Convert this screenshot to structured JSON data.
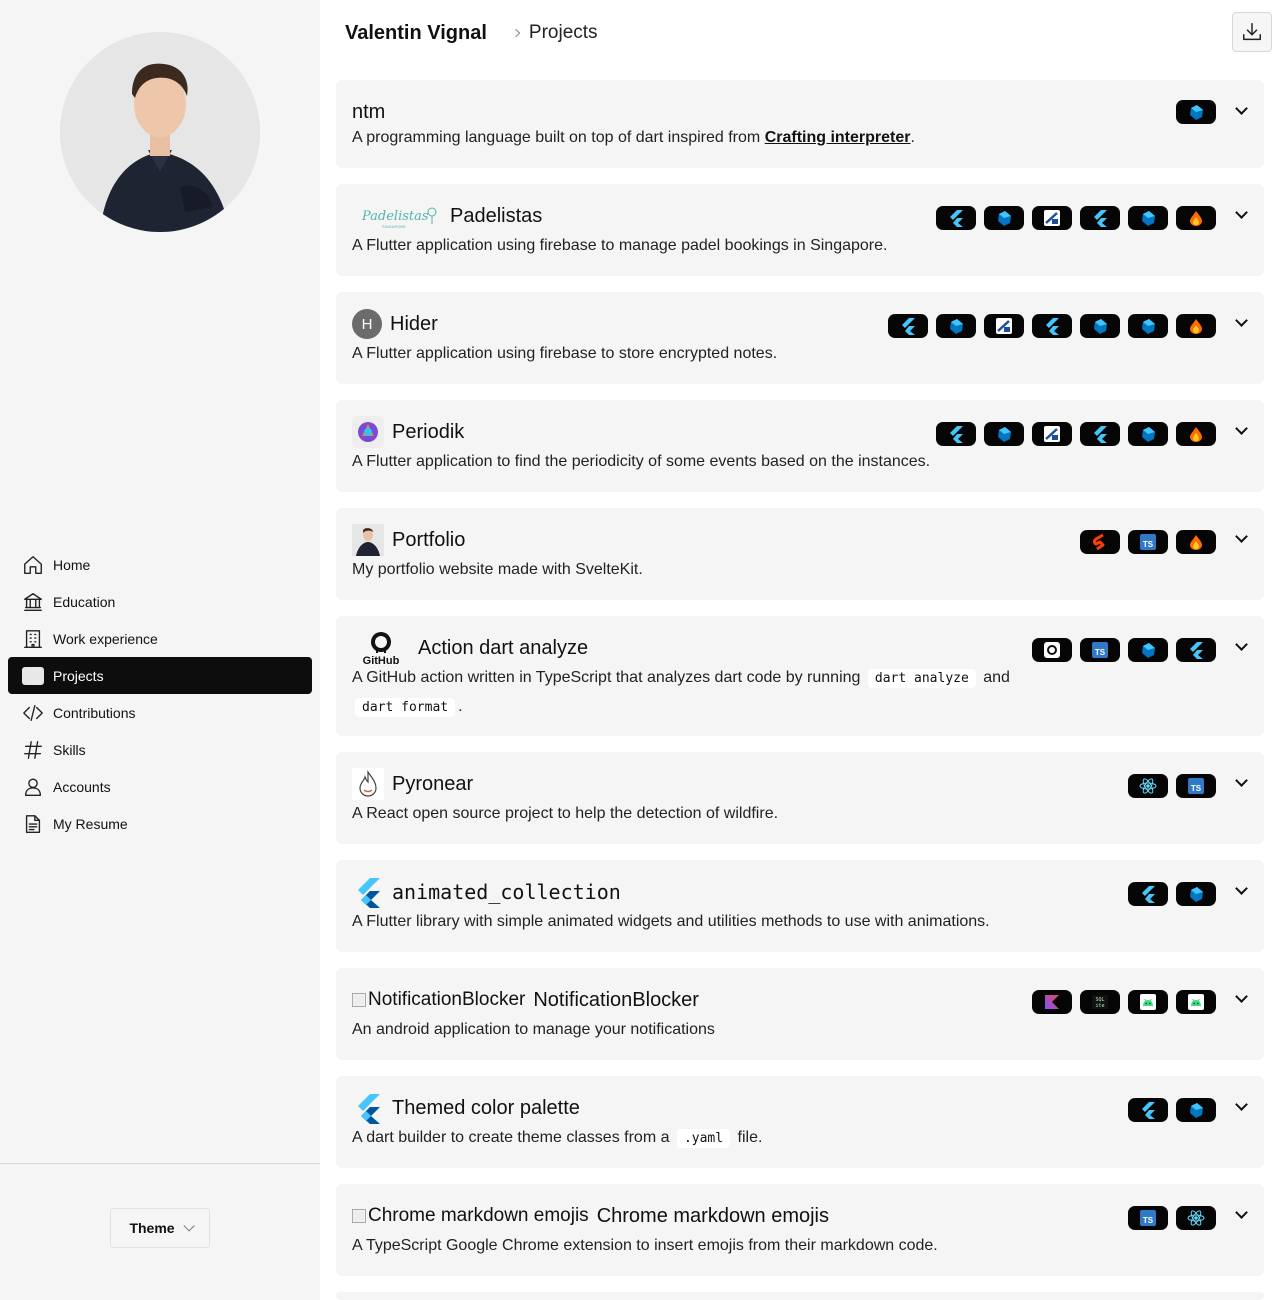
{
  "breadcrumb": {
    "root": "Valentin Vignal",
    "current": "Projects"
  },
  "nav": [
    {
      "label": "Home",
      "icon": "home-icon"
    },
    {
      "label": "Education",
      "icon": "bank-icon"
    },
    {
      "label": "Work experience",
      "icon": "building-icon"
    },
    {
      "label": "Projects",
      "icon": "projects-icon",
      "active": true
    },
    {
      "label": "Contributions",
      "icon": "code-icon"
    },
    {
      "label": "Skills",
      "icon": "hash-icon"
    },
    {
      "label": "Accounts",
      "icon": "user-icon"
    },
    {
      "label": "My Resume",
      "icon": "file-icon"
    }
  ],
  "theme": {
    "label": "Theme"
  },
  "projects": [
    {
      "name": "ntm",
      "description_before": "A programming language built on top of dart inspired from ",
      "link": "Crafting interpreter",
      "description_after": ".",
      "badges": [
        "dart"
      ]
    },
    {
      "name": "Padelistas",
      "logo_text": "Padelistas",
      "description": "A Flutter application using firebase to manage padel bookings in Singapore.",
      "badges": [
        "flutter",
        "dart",
        "codemagic",
        "flutter",
        "dart",
        "firebase"
      ]
    },
    {
      "name": "Hider",
      "logo_letter": "H",
      "description": "A Flutter application using firebase to store encrypted notes.",
      "badges": [
        "flutter",
        "dart",
        "codemagic",
        "flutter",
        "dart",
        "dart",
        "firebase"
      ]
    },
    {
      "name": "Periodik",
      "description": "A Flutter application to find the periodicity of some events based on the instances.",
      "badges": [
        "flutter",
        "dart",
        "codemagic",
        "flutter",
        "dart",
        "firebase"
      ]
    },
    {
      "name": "Portfolio",
      "description": "My portfolio website made with SvelteKit.",
      "badges": [
        "svelte",
        "typescript",
        "firebase"
      ]
    },
    {
      "name": "Action dart analyze",
      "logo_text": "GitHub",
      "description_before": "A GitHub action written in TypeScript that analyzes dart code by running ",
      "code1": "dart analyze",
      "description_mid": " and ",
      "code2": "dart format",
      "description_after": ".",
      "badges": [
        "github",
        "typescript",
        "dart",
        "flutter"
      ]
    },
    {
      "name": "Pyronear",
      "description": "A React open source project to help the detection of wildfire.",
      "badges": [
        "react",
        "typescript"
      ]
    },
    {
      "name": "animated_collection",
      "description": "A Flutter library with simple animated widgets and utilities methods to use with animations.",
      "badges": [
        "flutter",
        "dart"
      ]
    },
    {
      "name": "NotificationBlocker",
      "alt_text": "NotificationBlocker",
      "description": "An android application to manage your notifications",
      "badges": [
        "kotlin",
        "sqlite",
        "android",
        "android"
      ]
    },
    {
      "name": "Themed color palette",
      "description_before": "A dart builder to create theme classes from a ",
      "code1": ".yaml",
      "description_after": " file.",
      "badges": [
        "flutter",
        "dart"
      ]
    },
    {
      "name": "Chrome markdown emojis",
      "alt_text": "Chrome markdown emojis",
      "description": "A TypeScript Google Chrome extension to insert emojis from their markdown code.",
      "badges": [
        "typescript",
        "react"
      ]
    }
  ],
  "colors": {
    "sidebar_bg": "#f5f5f5",
    "active_bg": "#0d0d0d",
    "card_bg": "#f5f5f5",
    "badge_bg": "#050505",
    "flutter_blue": "#47c5fb",
    "dart_blue": "#0175c2"
  }
}
